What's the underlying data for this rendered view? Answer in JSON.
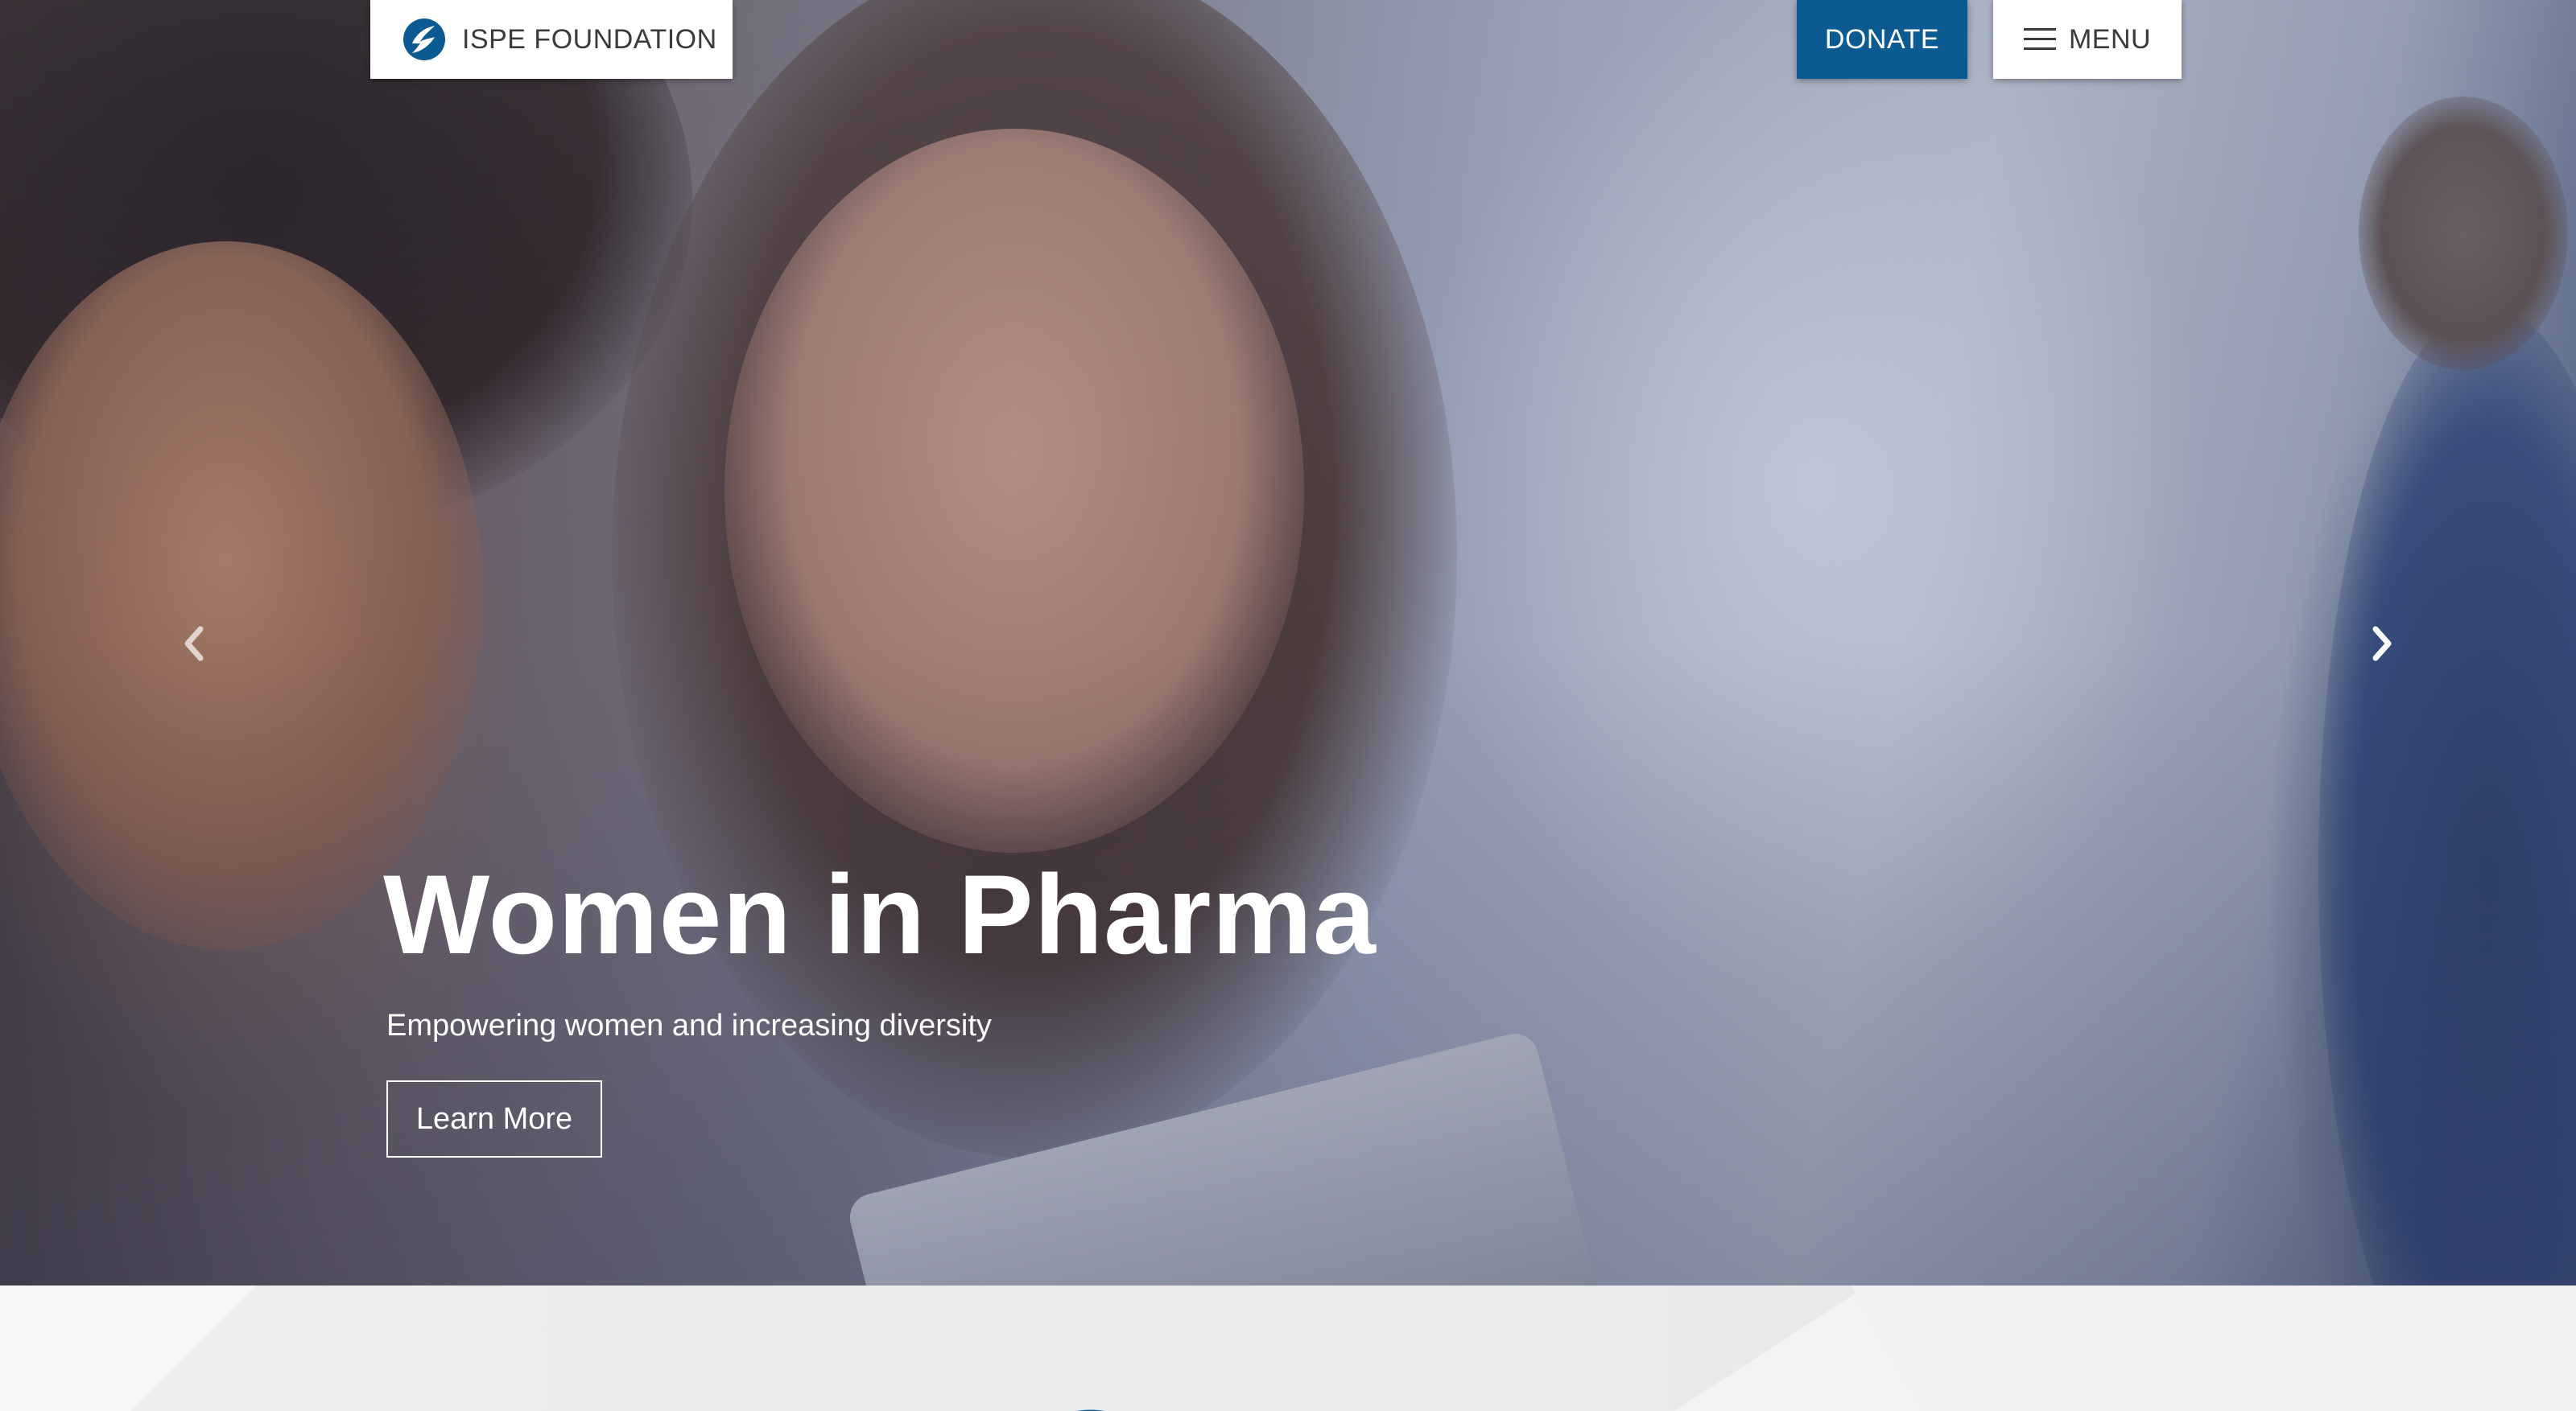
{
  "header": {
    "brand_name": "ISPE FOUNDATION",
    "donate_label": "DONATE",
    "menu_label": "MENU"
  },
  "hero": {
    "title": "Women in Pharma",
    "subtitle": "Empowering women and increasing diversity",
    "cta_label": "Learn More"
  },
  "icons": {
    "brand_logo": "ispe-logo-icon",
    "menu": "hamburger-icon",
    "prev": "chevron-left-icon",
    "next": "chevron-right-icon"
  },
  "colors": {
    "brand_blue": "#0b5a92",
    "white": "#ffffff",
    "text_dark": "#3a3a3a"
  }
}
